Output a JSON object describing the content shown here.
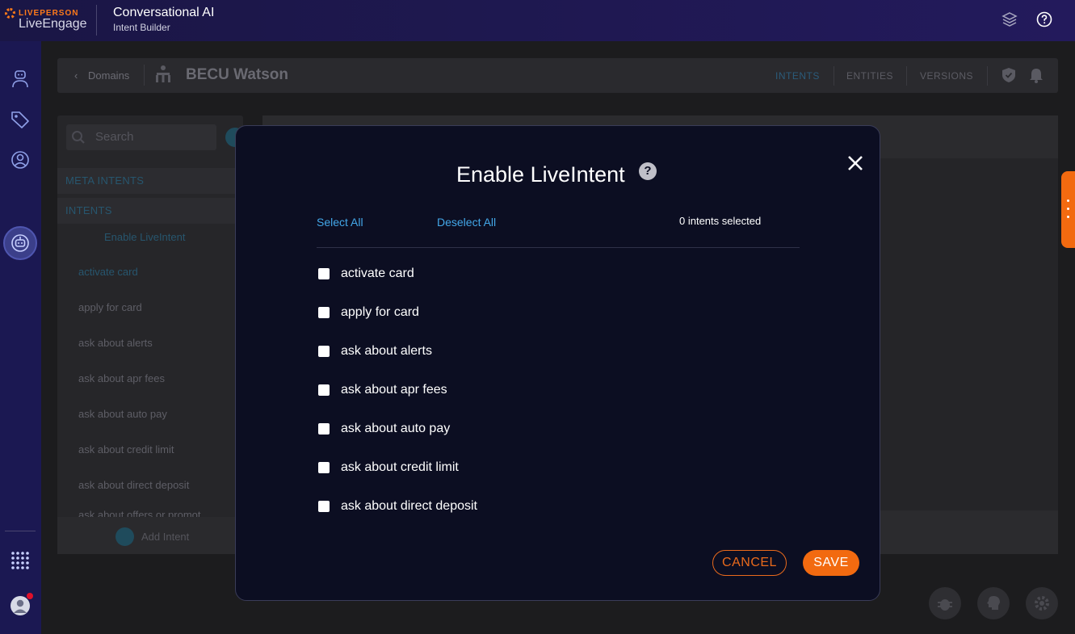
{
  "header": {
    "brand_top": "LIVEPERSON",
    "brand_name": "LiveEngage",
    "app_title": "Conversational AI",
    "app_subtitle": "Intent Builder"
  },
  "breadcrumb": {
    "back_label": "Domains",
    "domain_title": "BECU Watson"
  },
  "top_tabs": [
    "INTENTS",
    "ENTITIES",
    "VERSIONS"
  ],
  "left_panel": {
    "search_placeholder": "Search",
    "meta_intents_label": "META INTENTS",
    "intents_label": "INTENTS",
    "enable_liveintent_link": "Enable LiveIntent",
    "intents": [
      "activate card",
      "apply for card",
      "ask about alerts",
      "ask about apr fees",
      "ask about auto pay",
      "ask about credit limit",
      "ask about direct deposit",
      "ask about offers or promot"
    ],
    "add_intent_label": "Add Intent"
  },
  "modal": {
    "title": "Enable LiveIntent",
    "help_glyph": "?",
    "select_all": "Select All",
    "deselect_all": "Deselect All",
    "selected_count": "0 intents selected",
    "options": [
      {
        "label": "activate card",
        "checked": false
      },
      {
        "label": "apply for card",
        "checked": false
      },
      {
        "label": "ask about alerts",
        "checked": false
      },
      {
        "label": "ask about apr fees",
        "checked": false
      },
      {
        "label": "ask about auto pay",
        "checked": false
      },
      {
        "label": "ask about credit limit",
        "checked": false
      },
      {
        "label": "ask about direct deposit",
        "checked": false
      }
    ],
    "cancel_label": "CANCEL",
    "save_label": "SAVE"
  },
  "colors": {
    "accent": "#f26a10",
    "link": "#43a7e8",
    "modal_bg": "#0c0e22",
    "header_bg": "#1a1645"
  },
  "icons": {
    "topbar": [
      "layers-icon",
      "help-icon"
    ],
    "leftnav": [
      "agent-bot-icon",
      "tag-icon",
      "user-circle-icon",
      "bot-icon",
      "apps-grid-icon",
      "avatar-icon"
    ],
    "fab": [
      "bug-icon",
      "brain-icon",
      "settings-icon"
    ]
  }
}
